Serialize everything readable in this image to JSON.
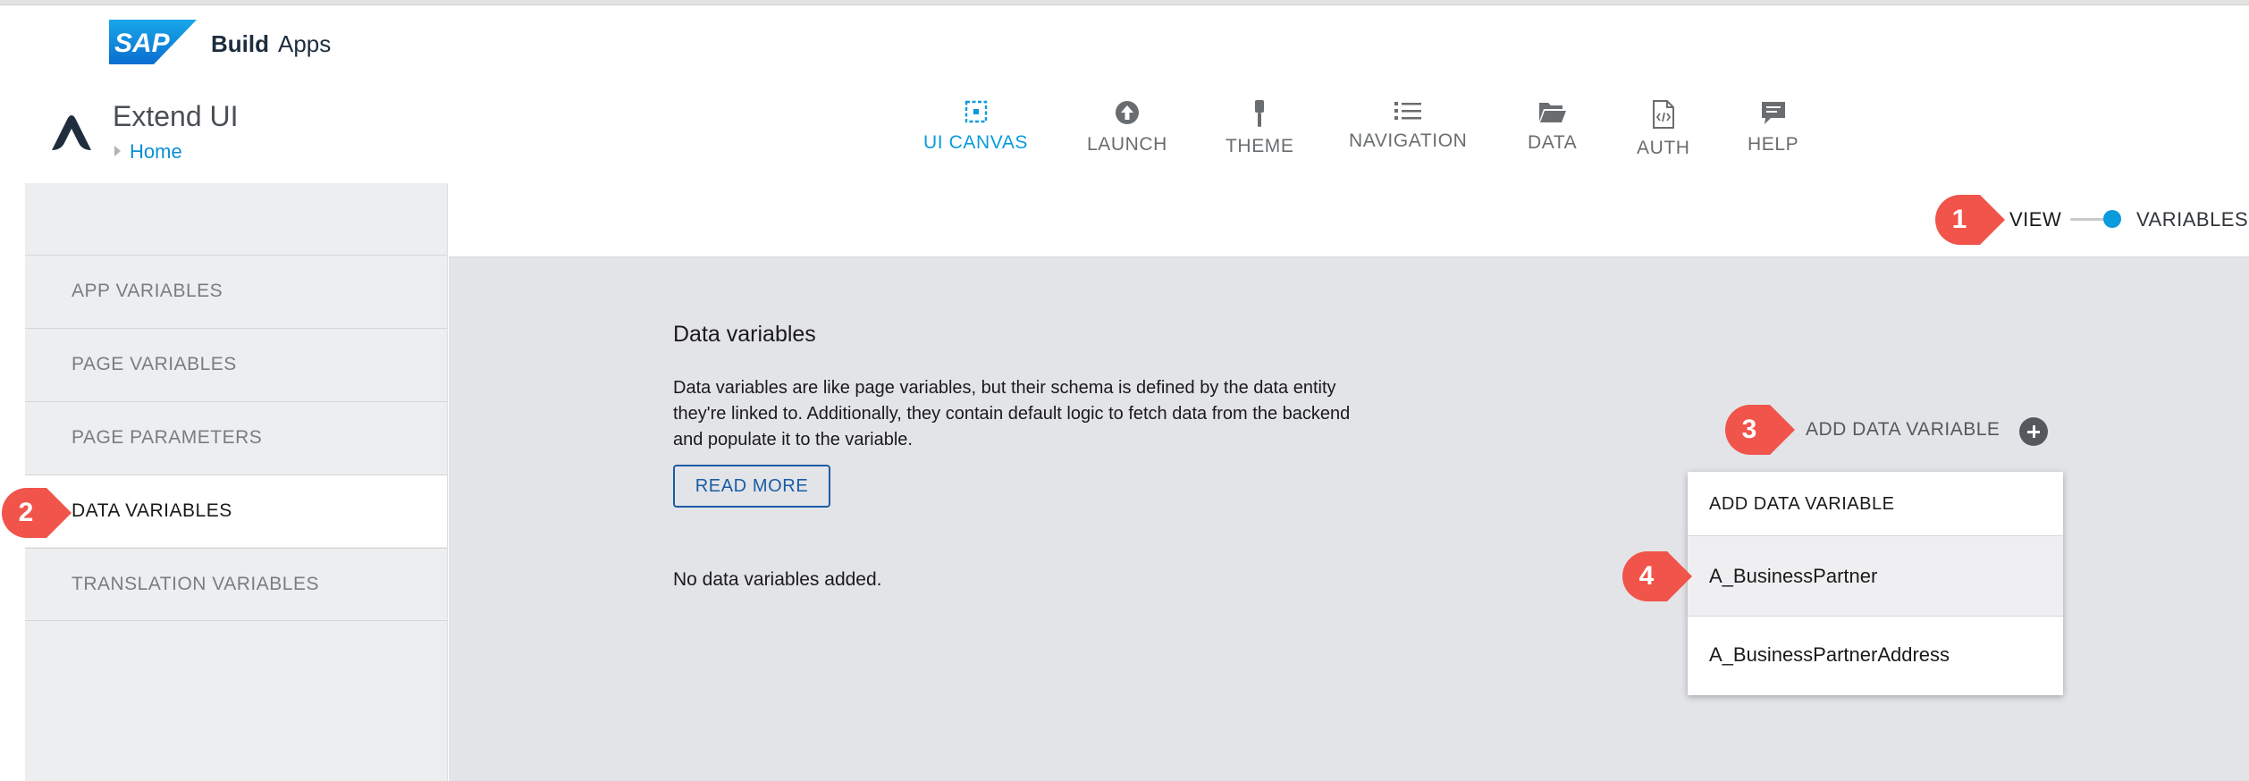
{
  "brand": {
    "logo_text": "SAP",
    "product_bold": "Build",
    "product": "Apps"
  },
  "app": {
    "title": "Extend UI",
    "breadcrumb": "Home"
  },
  "nav": [
    {
      "label": "UI CANVAS",
      "icon": "canvas-icon",
      "active": true
    },
    {
      "label": "LAUNCH",
      "icon": "launch-icon"
    },
    {
      "label": "THEME",
      "icon": "theme-brush-icon"
    },
    {
      "label": "NAVIGATION",
      "icon": "list-icon"
    },
    {
      "label": "DATA",
      "icon": "folder-icon"
    },
    {
      "label": "AUTH",
      "icon": "code-file-icon"
    },
    {
      "label": "HELP",
      "icon": "chat-icon"
    }
  ],
  "toggle": {
    "left": "VIEW",
    "right": "VARIABLES",
    "selected": "VARIABLES"
  },
  "sidebar": {
    "items": [
      {
        "label": "APP VARIABLES"
      },
      {
        "label": "PAGE VARIABLES"
      },
      {
        "label": "PAGE PARAMETERS"
      },
      {
        "label": "DATA VARIABLES",
        "active": true
      },
      {
        "label": "TRANSLATION VARIABLES"
      }
    ]
  },
  "main": {
    "title": "Data variables",
    "description": "Data variables are like page variables, but their schema is defined by the data entity they're linked to. Additionally, they contain default logic to fetch data from the backend and populate it to the variable.",
    "read_more": "READ MORE",
    "empty": "No data variables added.",
    "add_label": "ADD DATA VARIABLE"
  },
  "dropdown": {
    "header": "ADD DATA VARIABLE",
    "items": [
      "A_BusinessPartner",
      "A_BusinessPartnerAddress"
    ]
  },
  "callouts": [
    "1",
    "2",
    "3",
    "4"
  ],
  "colors": {
    "accent": "#0a9bdc",
    "callout": "#f0544a",
    "link": "#1a5ca6"
  }
}
